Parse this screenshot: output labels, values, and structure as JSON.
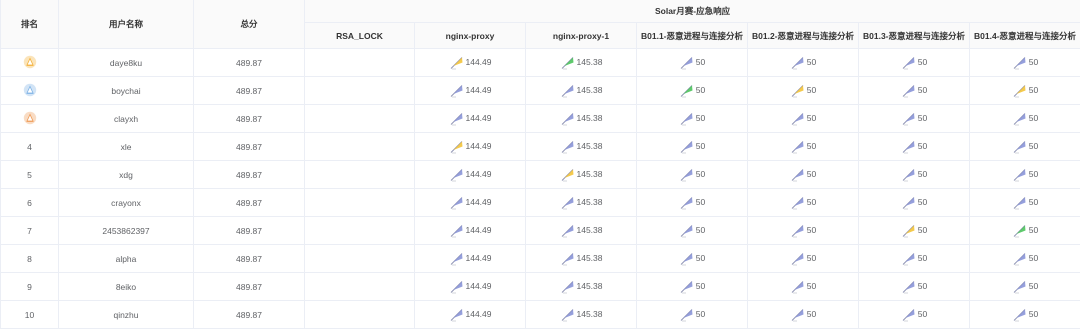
{
  "headers": {
    "rank": "排名",
    "user": "用户名称",
    "total": "总分",
    "group": "Solar月赛-应急响应",
    "challenges": [
      "RSA_LOCK",
      "nginx-proxy",
      "nginx-proxy-1",
      "B01.1-恶意进程与连接分析",
      "B01.2-恶意进程与连接分析",
      "B01.3-恶意进程与连接分析",
      "B01.4-恶意进程与连接分析"
    ]
  },
  "colors": {
    "gold": "#f3b13a",
    "silver": "#7fb3e6",
    "bronze": "#ef9a55",
    "first_blood": "#f3c43a",
    "green": "#4cc45c",
    "blue": "#8a95d8"
  },
  "rows": [
    {
      "rank": "",
      "medal": "gold",
      "user": "daye8ku",
      "total": "489.87",
      "scores": [
        {
          "value": "",
          "flag": "none"
        },
        {
          "value": "144.49",
          "flag": "gold"
        },
        {
          "value": "145.38",
          "flag": "green"
        },
        {
          "value": "50",
          "flag": "blue"
        },
        {
          "value": "50",
          "flag": "blue"
        },
        {
          "value": "50",
          "flag": "blue"
        },
        {
          "value": "50",
          "flag": "blue"
        }
      ]
    },
    {
      "rank": "",
      "medal": "silver",
      "user": "boychai",
      "total": "489.87",
      "scores": [
        {
          "value": "",
          "flag": "none"
        },
        {
          "value": "144.49",
          "flag": "blue"
        },
        {
          "value": "145.38",
          "flag": "blue"
        },
        {
          "value": "50",
          "flag": "green"
        },
        {
          "value": "50",
          "flag": "gold"
        },
        {
          "value": "50",
          "flag": "blue"
        },
        {
          "value": "50",
          "flag": "gold"
        }
      ]
    },
    {
      "rank": "",
      "medal": "bronze",
      "user": "clayxh",
      "total": "489.87",
      "scores": [
        {
          "value": "",
          "flag": "none"
        },
        {
          "value": "144.49",
          "flag": "blue"
        },
        {
          "value": "145.38",
          "flag": "blue"
        },
        {
          "value": "50",
          "flag": "blue"
        },
        {
          "value": "50",
          "flag": "blue"
        },
        {
          "value": "50",
          "flag": "blue"
        },
        {
          "value": "50",
          "flag": "blue"
        }
      ]
    },
    {
      "rank": "4",
      "medal": "none",
      "user": "xle",
      "total": "489.87",
      "scores": [
        {
          "value": "",
          "flag": "none"
        },
        {
          "value": "144.49",
          "flag": "gold"
        },
        {
          "value": "145.38",
          "flag": "blue"
        },
        {
          "value": "50",
          "flag": "blue"
        },
        {
          "value": "50",
          "flag": "blue"
        },
        {
          "value": "50",
          "flag": "blue"
        },
        {
          "value": "50",
          "flag": "blue"
        }
      ]
    },
    {
      "rank": "5",
      "medal": "none",
      "user": "xdg",
      "total": "489.87",
      "scores": [
        {
          "value": "",
          "flag": "none"
        },
        {
          "value": "144.49",
          "flag": "blue"
        },
        {
          "value": "145.38",
          "flag": "gold"
        },
        {
          "value": "50",
          "flag": "blue"
        },
        {
          "value": "50",
          "flag": "blue"
        },
        {
          "value": "50",
          "flag": "blue"
        },
        {
          "value": "50",
          "flag": "blue"
        }
      ]
    },
    {
      "rank": "6",
      "medal": "none",
      "user": "crayonx",
      "total": "489.87",
      "scores": [
        {
          "value": "",
          "flag": "none"
        },
        {
          "value": "144.49",
          "flag": "blue"
        },
        {
          "value": "145.38",
          "flag": "blue"
        },
        {
          "value": "50",
          "flag": "blue"
        },
        {
          "value": "50",
          "flag": "blue"
        },
        {
          "value": "50",
          "flag": "blue"
        },
        {
          "value": "50",
          "flag": "blue"
        }
      ]
    },
    {
      "rank": "7",
      "medal": "none",
      "user": "2453862397",
      "total": "489.87",
      "scores": [
        {
          "value": "",
          "flag": "none"
        },
        {
          "value": "144.49",
          "flag": "blue"
        },
        {
          "value": "145.38",
          "flag": "blue"
        },
        {
          "value": "50",
          "flag": "blue"
        },
        {
          "value": "50",
          "flag": "blue"
        },
        {
          "value": "50",
          "flag": "gold"
        },
        {
          "value": "50",
          "flag": "green"
        }
      ]
    },
    {
      "rank": "8",
      "medal": "none",
      "user": "alpha",
      "total": "489.87",
      "scores": [
        {
          "value": "",
          "flag": "none"
        },
        {
          "value": "144.49",
          "flag": "blue"
        },
        {
          "value": "145.38",
          "flag": "blue"
        },
        {
          "value": "50",
          "flag": "blue"
        },
        {
          "value": "50",
          "flag": "blue"
        },
        {
          "value": "50",
          "flag": "blue"
        },
        {
          "value": "50",
          "flag": "blue"
        }
      ]
    },
    {
      "rank": "9",
      "medal": "none",
      "user": "8eiko",
      "total": "489.87",
      "scores": [
        {
          "value": "",
          "flag": "none"
        },
        {
          "value": "144.49",
          "flag": "blue"
        },
        {
          "value": "145.38",
          "flag": "blue"
        },
        {
          "value": "50",
          "flag": "blue"
        },
        {
          "value": "50",
          "flag": "blue"
        },
        {
          "value": "50",
          "flag": "blue"
        },
        {
          "value": "50",
          "flag": "blue"
        }
      ]
    },
    {
      "rank": "10",
      "medal": "none",
      "user": "qinzhu",
      "total": "489.87",
      "scores": [
        {
          "value": "",
          "flag": "none"
        },
        {
          "value": "144.49",
          "flag": "blue"
        },
        {
          "value": "145.38",
          "flag": "blue"
        },
        {
          "value": "50",
          "flag": "blue"
        },
        {
          "value": "50",
          "flag": "blue"
        },
        {
          "value": "50",
          "flag": "blue"
        },
        {
          "value": "50",
          "flag": "blue"
        }
      ]
    }
  ]
}
